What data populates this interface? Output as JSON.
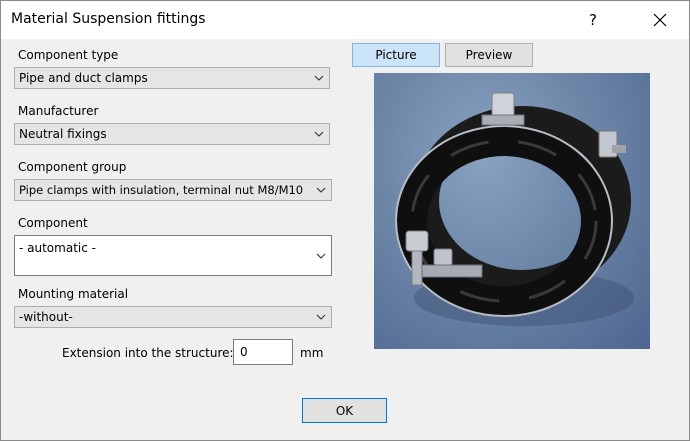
{
  "window": {
    "title": "Material Suspension fittings",
    "help_label": "?"
  },
  "form": {
    "component_type": {
      "label": "Component type",
      "value": "Pipe and duct clamps"
    },
    "manufacturer": {
      "label": "Manufacturer",
      "value": "Neutral fixings"
    },
    "component_group": {
      "label": "Component group",
      "value": "Pipe clamps with insulation, terminal nut M8/M10"
    },
    "component": {
      "label": "Component",
      "value": "- automatic -"
    },
    "mounting_material": {
      "label": "Mounting material",
      "value": "-without-"
    },
    "extension": {
      "label": "Extension into the structure:",
      "value": "0",
      "unit": "mm"
    }
  },
  "tabs": [
    {
      "label": "Picture",
      "active": true
    },
    {
      "label": "Preview",
      "active": false
    }
  ],
  "buttons": {
    "ok": "OK"
  },
  "colors": {
    "accent": "#0078d7",
    "active_tab": "#cce4f7"
  }
}
